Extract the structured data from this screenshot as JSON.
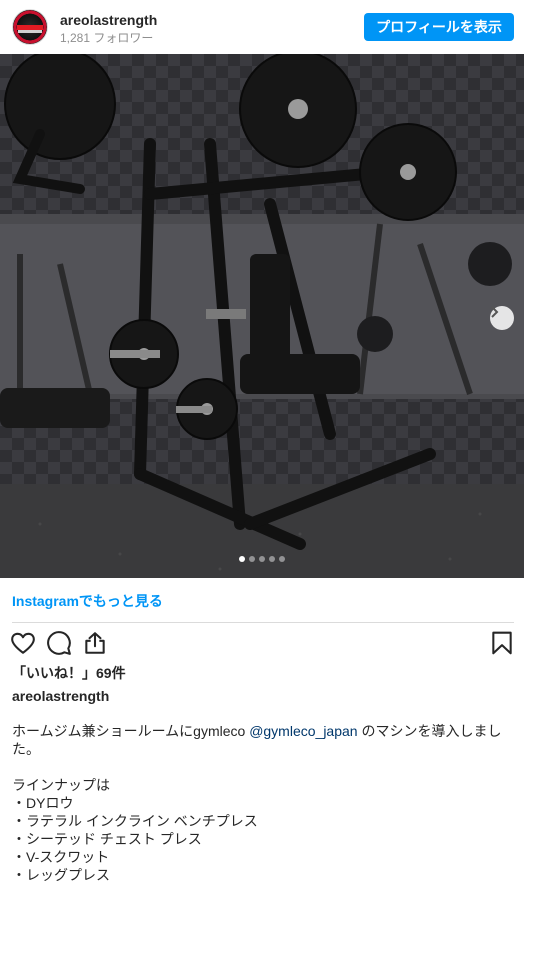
{
  "header": {
    "username": "areolastrength",
    "followers": "1,281 フォロワー",
    "profile_button": "プロフィールを表示"
  },
  "media": {
    "carousel_count": 5,
    "active_index": 0
  },
  "more_link": "Instagramでもっと見る",
  "likes": "「いいね！」69件",
  "caption": {
    "username": "areolastrength",
    "line1_pre": "ホームジム兼ショールームにgymleco ",
    "mention": "@gymleco_japan",
    "line1_post": " のマシンを導入しました。",
    "lineup_title": "ラインナップは",
    "items": [
      "・DYロウ",
      "・ラテラル インクライン ベンチプレス",
      "・シーテッド チェスト プレス",
      "・V-スクワット",
      "・レッグプレス"
    ]
  },
  "colors": {
    "accent": "#0095f6",
    "mention": "#00376b",
    "muted": "#8e8e8e"
  }
}
